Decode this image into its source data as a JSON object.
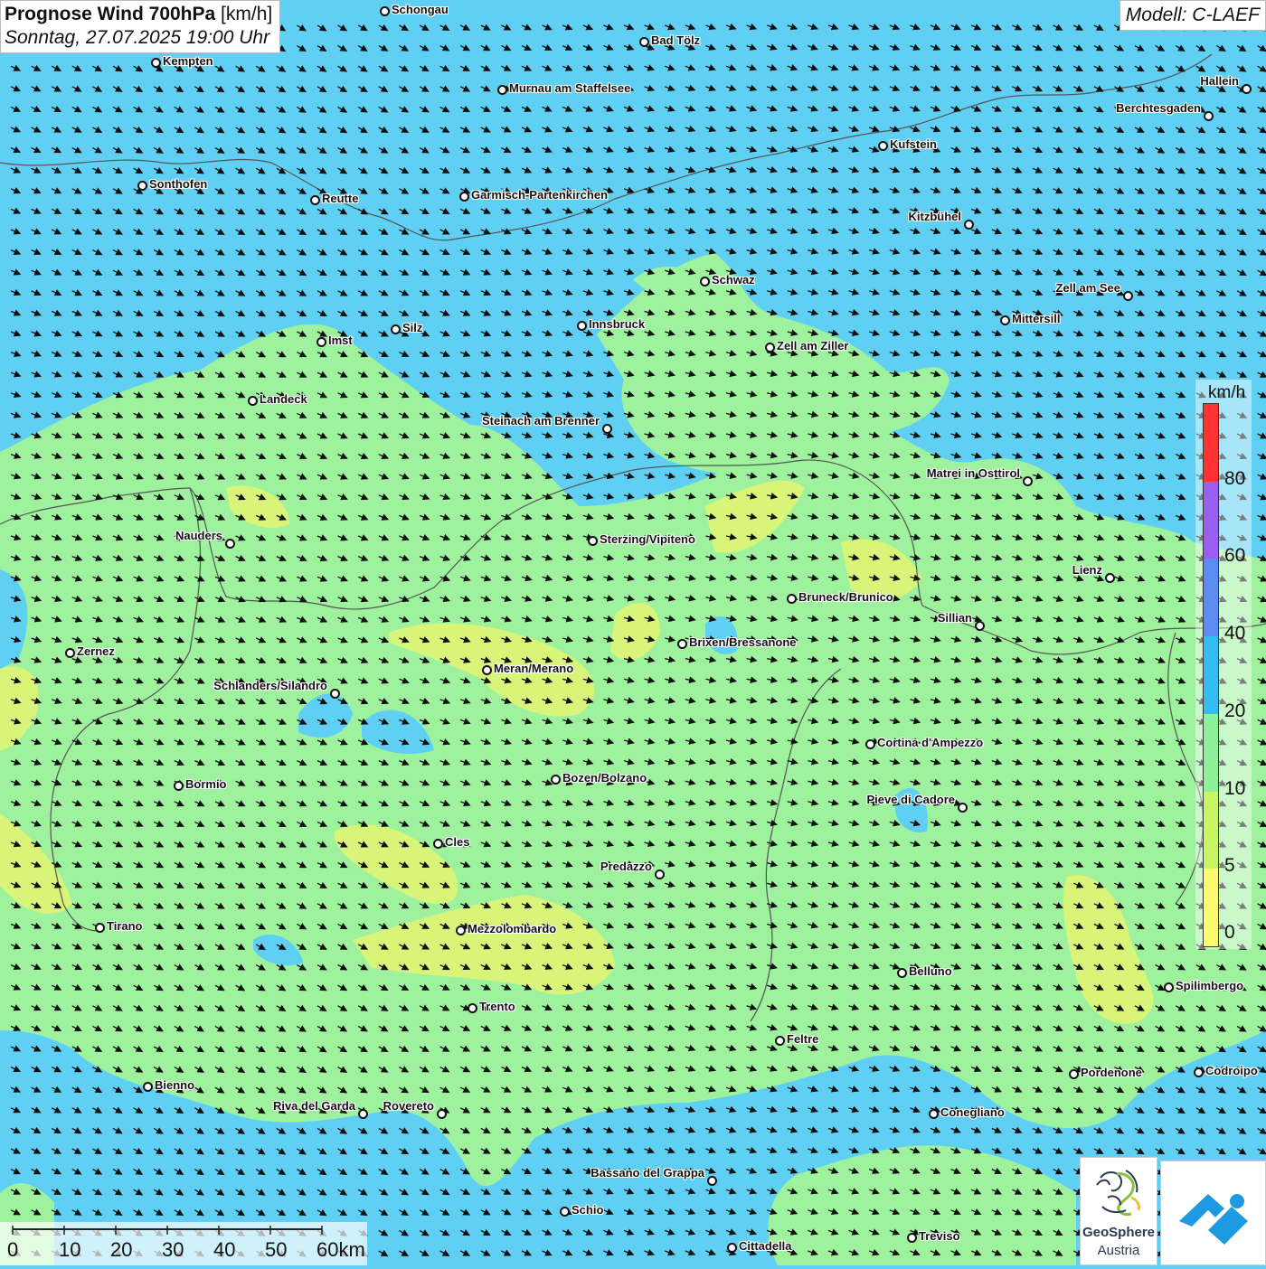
{
  "title": {
    "main": "Prognose Wind 700hPa",
    "unit": "[km/h]",
    "date": "Sonntag, 27.07.2025 19:00 Uhr"
  },
  "model": "Modell: C-LAEF",
  "legend": {
    "unit": "km/h",
    "labels": [
      "80",
      "60",
      "40",
      "20",
      "10",
      "5",
      "0"
    ],
    "colors": [
      "#ff3232",
      "#9a5ff0",
      "#5c8cf0",
      "#33bdf0",
      "#8ff09a",
      "#c9f564",
      "#fdfb70"
    ]
  },
  "scale": {
    "labels": [
      "0",
      "10",
      "20",
      "30",
      "40",
      "50",
      "60km"
    ]
  },
  "logo": {
    "name": "GeoSphere",
    "sub": "Austria"
  },
  "colors": {
    "sea_blue": "#5fd0f3",
    "land_green": "#9ef29e",
    "calm_yellow": "#d8f57a",
    "arrow": "#111111"
  },
  "wind_arrow_direction": "towards south-east",
  "cities": [
    {
      "name": "Schongau",
      "side": "right"
    },
    {
      "name": "Bad Tölz",
      "side": "right"
    },
    {
      "name": "Kempten",
      "side": "right"
    },
    {
      "name": "Murnau am Staffelsee",
      "side": "right"
    },
    {
      "name": "Hallein",
      "side": "left"
    },
    {
      "name": "Berchtesgaden",
      "side": "left"
    },
    {
      "name": "Kufstein",
      "side": "right"
    },
    {
      "name": "Sonthofen",
      "side": "right"
    },
    {
      "name": "Reutte",
      "side": "right"
    },
    {
      "name": "Garmisch-Partenkirchen",
      "side": "right"
    },
    {
      "name": "Kitzbühel",
      "side": "left"
    },
    {
      "name": "Schwaz",
      "side": "right"
    },
    {
      "name": "Zell am See",
      "side": "left"
    },
    {
      "name": "Mittersill",
      "side": "right"
    },
    {
      "name": "Innsbruck",
      "side": "right"
    },
    {
      "name": "Silz",
      "side": "right"
    },
    {
      "name": "Imst",
      "side": "right"
    },
    {
      "name": "Zell am Ziller",
      "side": "right"
    },
    {
      "name": "Landeck",
      "side": "right"
    },
    {
      "name": "Steinach am Brenner",
      "side": "left"
    },
    {
      "name": "Matrei in Osttirol",
      "side": "left"
    },
    {
      "name": "Nauders",
      "side": "left"
    },
    {
      "name": "Sterzing/Vipiteno",
      "side": "right"
    },
    {
      "name": "Lienz",
      "side": "left"
    },
    {
      "name": "Bruneck/Brunico",
      "side": "right"
    },
    {
      "name": "Sillian",
      "side": "left"
    },
    {
      "name": "Brixen/Bressanone",
      "side": "right"
    },
    {
      "name": "Zernez",
      "side": "right"
    },
    {
      "name": "Meran/Merano",
      "side": "right"
    },
    {
      "name": "Schlanders/Silandro",
      "side": "left"
    },
    {
      "name": "Cortina d'Ampezzo",
      "side": "right"
    },
    {
      "name": "Bozen/Bolzano",
      "side": "right"
    },
    {
      "name": "Bormio",
      "side": "right"
    },
    {
      "name": "Pieve di Cadore",
      "side": "left"
    },
    {
      "name": "Cles",
      "side": "right"
    },
    {
      "name": "Predazzo",
      "side": "left"
    },
    {
      "name": "Tirano",
      "side": "right"
    },
    {
      "name": "Mezzolombardo",
      "side": "right"
    },
    {
      "name": "Belluno",
      "side": "right"
    },
    {
      "name": "Spilimbergo",
      "side": "right"
    },
    {
      "name": "Trento",
      "side": "right"
    },
    {
      "name": "Feltre",
      "side": "right"
    },
    {
      "name": "Pordenone",
      "side": "right"
    },
    {
      "name": "Codroipo",
      "side": "right"
    },
    {
      "name": "Bienno",
      "side": "right"
    },
    {
      "name": "Riva del Garda",
      "side": "left"
    },
    {
      "name": "Rovereto",
      "side": "left"
    },
    {
      "name": "Conegliano",
      "side": "right"
    },
    {
      "name": "Bassano del Grappa",
      "side": "left"
    },
    {
      "name": "Schio",
      "side": "right"
    },
    {
      "name": "Treviso",
      "side": "right"
    },
    {
      "name": "Cittadella",
      "side": "right"
    }
  ]
}
